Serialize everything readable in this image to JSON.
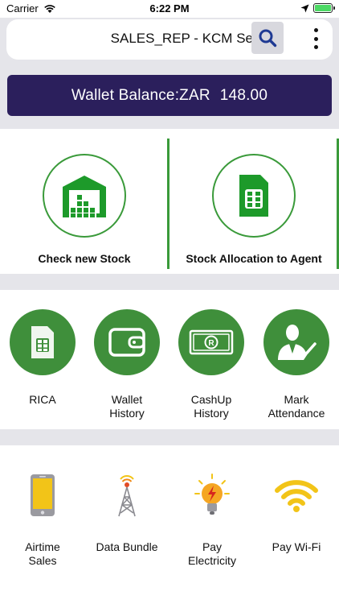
{
  "status_bar": {
    "carrier": "Carrier",
    "time": "6:22 PM"
  },
  "header": {
    "title": "SALES_REP - KCM Sello",
    "search_icon": "search-icon",
    "menu_icon": "more-vertical-icon"
  },
  "wallet": {
    "label": "Wallet Balance:ZAR",
    "amount": "148.00",
    "background": "#2b1f5c"
  },
  "stock_actions": [
    {
      "label": "Check new Stock",
      "icon": "warehouse-icon"
    },
    {
      "label": "Stock Allocation to Agent",
      "icon": "sim-card-icon"
    }
  ],
  "services": [
    {
      "label": "RICA",
      "icon": "sim-card-icon"
    },
    {
      "label": "Wallet\nHistory",
      "icon": "wallet-icon"
    },
    {
      "label": "CashUp\nHistory",
      "icon": "cash-icon"
    },
    {
      "label": "Mark\nAttendance",
      "icon": "person-check-icon"
    }
  ],
  "utilities": [
    {
      "label": "Airtime\nSales",
      "icon": "phone-icon"
    },
    {
      "label": "Data Bundle",
      "icon": "tower-icon"
    },
    {
      "label": "Pay\nElectricity",
      "icon": "bulb-icon"
    },
    {
      "label": "Pay Wi-Fi",
      "icon": "wifi-icon"
    }
  ],
  "colors": {
    "accent_green": "#3f8f3b",
    "divider_gray": "#e5e5ea",
    "wallet_bg": "#2b1f5c"
  }
}
